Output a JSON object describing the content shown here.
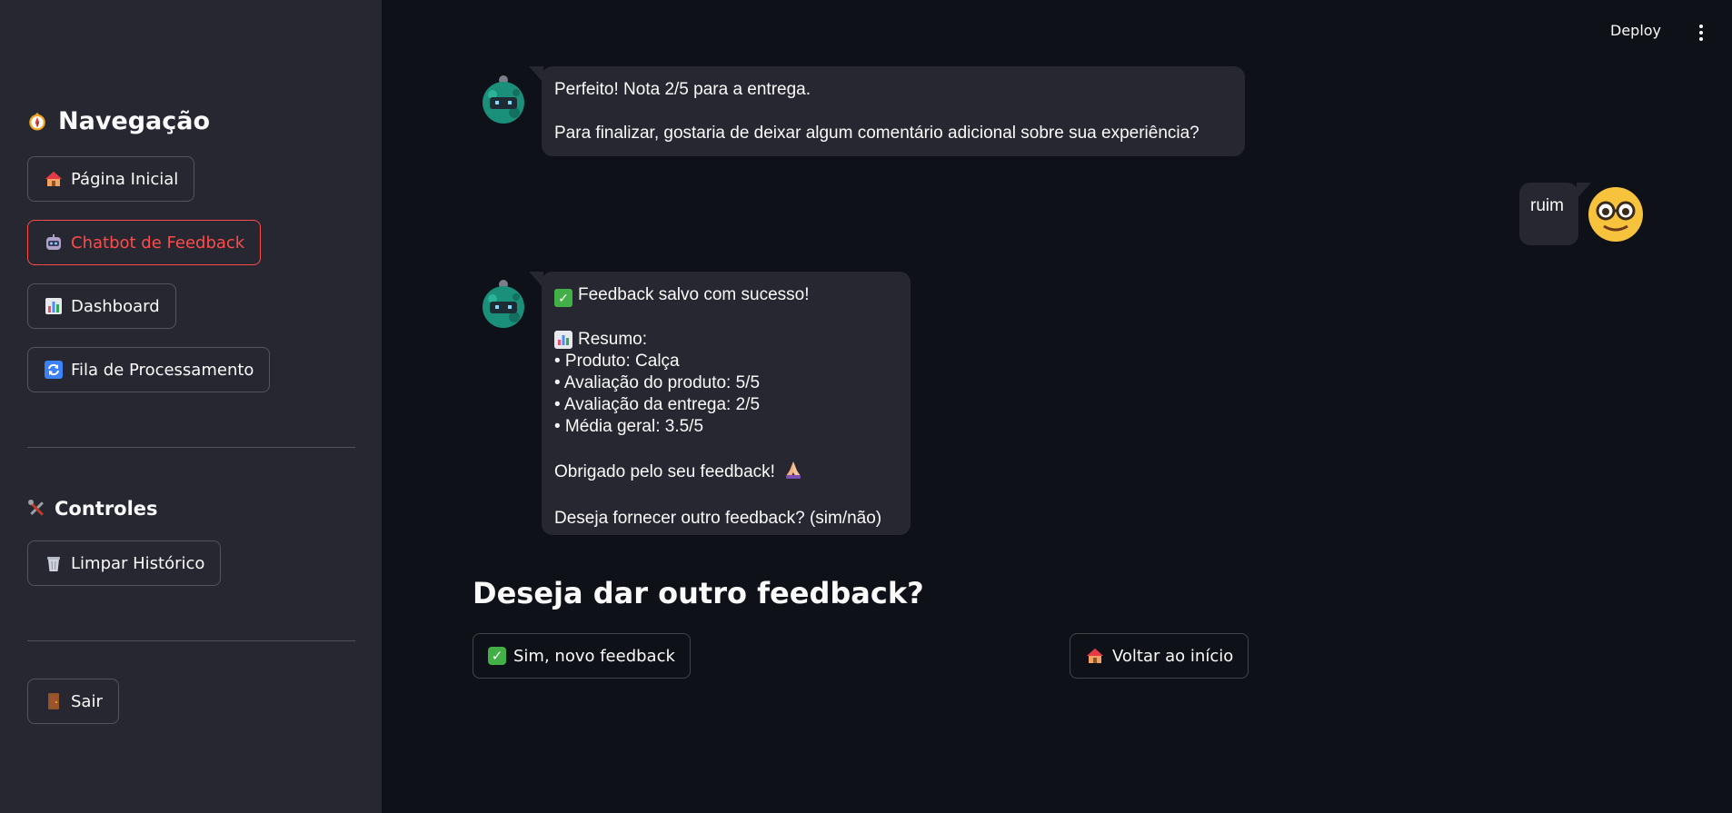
{
  "header": {
    "deploy_label": "Deploy",
    "menu_icon": "more-vertical-icon"
  },
  "sidebar": {
    "nav_title": "Navegação",
    "nav_icon": "compass-icon",
    "nav_items": [
      {
        "label": "Página Inicial",
        "icon": "house-icon",
        "active": false
      },
      {
        "label": "Chatbot de Feedback",
        "icon": "robot-icon",
        "active": true
      },
      {
        "label": "Dashboard",
        "icon": "bar-chart-icon",
        "active": false
      },
      {
        "label": "Fila de Processamento",
        "icon": "refresh-icon",
        "active": false
      }
    ],
    "controls_title": "Controles",
    "controls_icon": "tools-icon",
    "clear_label": "Limpar Histórico",
    "clear_icon": "wastebasket-icon",
    "logout_label": "Sair",
    "logout_icon": "door-icon"
  },
  "chat": {
    "messages": [
      {
        "role": "assistant",
        "lines": [
          "Perfeito! Nota 2/5 para a entrega.",
          "",
          "Para finalizar, gostaria de deixar algum comentário adicional sobre sua experiência?"
        ]
      },
      {
        "role": "user",
        "text": "ruim"
      },
      {
        "role": "assistant",
        "success": "Feedback salvo com sucesso!",
        "summary_title": "Resumo:",
        "summary_items": [
          "• Produto: Calça",
          "• Avaliação do produto: 5/5",
          "• Avaliação da entrega: 2/5",
          "• Média geral: 3.5/5"
        ],
        "thanks": "Obrigado pelo seu feedback!",
        "question": "Deseja fornecer outro feedback? (sim/não)"
      }
    ]
  },
  "prompt": {
    "heading": "Deseja dar outro feedback?",
    "yes_label": "Sim, novo feedback",
    "home_label": "Voltar ao início"
  },
  "colors": {
    "accent": "#ff4b4b",
    "sidebar_bg": "#262730",
    "main_bg": "#0e1117",
    "check_green": "#43b047"
  }
}
